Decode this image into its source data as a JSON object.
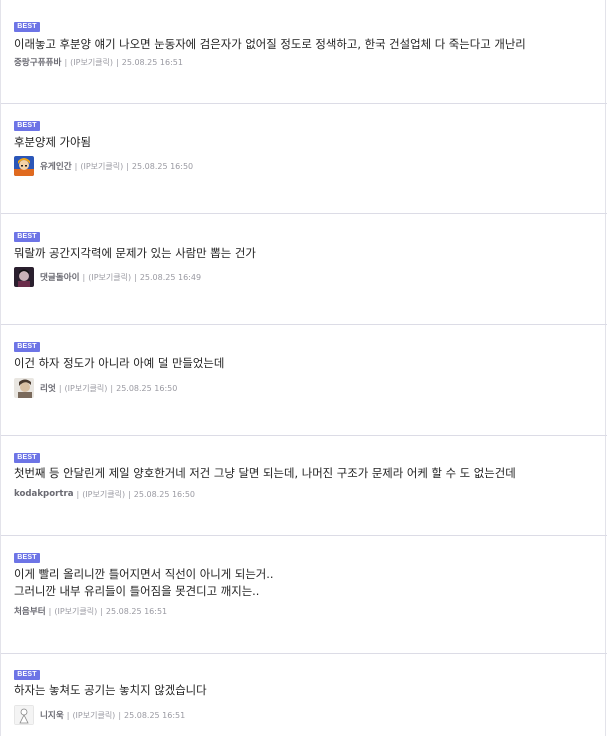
{
  "badge_label": "BEST",
  "comments": [
    {
      "text_lines": [
        "이래놓고 후분양 얘기 나오면 눈동자에 검은자가 없어질 정도로 정색하고, 한국 건설업체 다 죽는다고 개난리"
      ],
      "nick": "중랑구퓨퓨바",
      "ip": "(IP보기클릭)",
      "time": "25.08.25 16:51",
      "avatar": null
    },
    {
      "text_lines": [
        "후분양제 가야됨"
      ],
      "nick": "유게인간",
      "ip": "(IP보기클릭)",
      "time": "25.08.25 16:50",
      "avatar": "anime-character-avatar"
    },
    {
      "text_lines": [
        "뭐랄까 공간지각력에 문제가 있는 사람만 뽑는 건가"
      ],
      "nick": "댓글돌아이",
      "ip": "(IP보기클릭)",
      "time": "25.08.25 16:49",
      "avatar": "dark-portrait-avatar"
    },
    {
      "text_lines": [
        "이건 하자 정도가 아니라 아예 덜 만들었는데"
      ],
      "nick": "리엇",
      "ip": "(IP보기클릭)",
      "time": "25.08.25 16:50",
      "avatar": "sketch-portrait-avatar"
    },
    {
      "text_lines": [
        "첫번째 등 안달린게 제일 양호한거네 저건 그냥 달면 되는데, 나머진 구조가 문제라 어케 할 수 도 없는건데"
      ],
      "nick": "kodakportra",
      "ip": "(IP보기클릭)",
      "time": "25.08.25 16:50",
      "avatar": null
    },
    {
      "text_lines": [
        "이게 빨리 올리니깐 틀어지면서 직선이 아니게 되는거..",
        "그러니깐 내부 유리들이 틀어짐을 못견디고 깨지는.."
      ],
      "nick": "처음부터",
      "ip": "(IP보기클릭)",
      "time": "25.08.25 16:51",
      "avatar": null
    },
    {
      "text_lines": [
        "하자는 놓쳐도 공기는 놓치지 않겠습니다"
      ],
      "nick": "니지욱",
      "ip": "(IP보기클릭)",
      "time": "25.08.25 16:51",
      "avatar": "white-figure-avatar"
    }
  ]
}
